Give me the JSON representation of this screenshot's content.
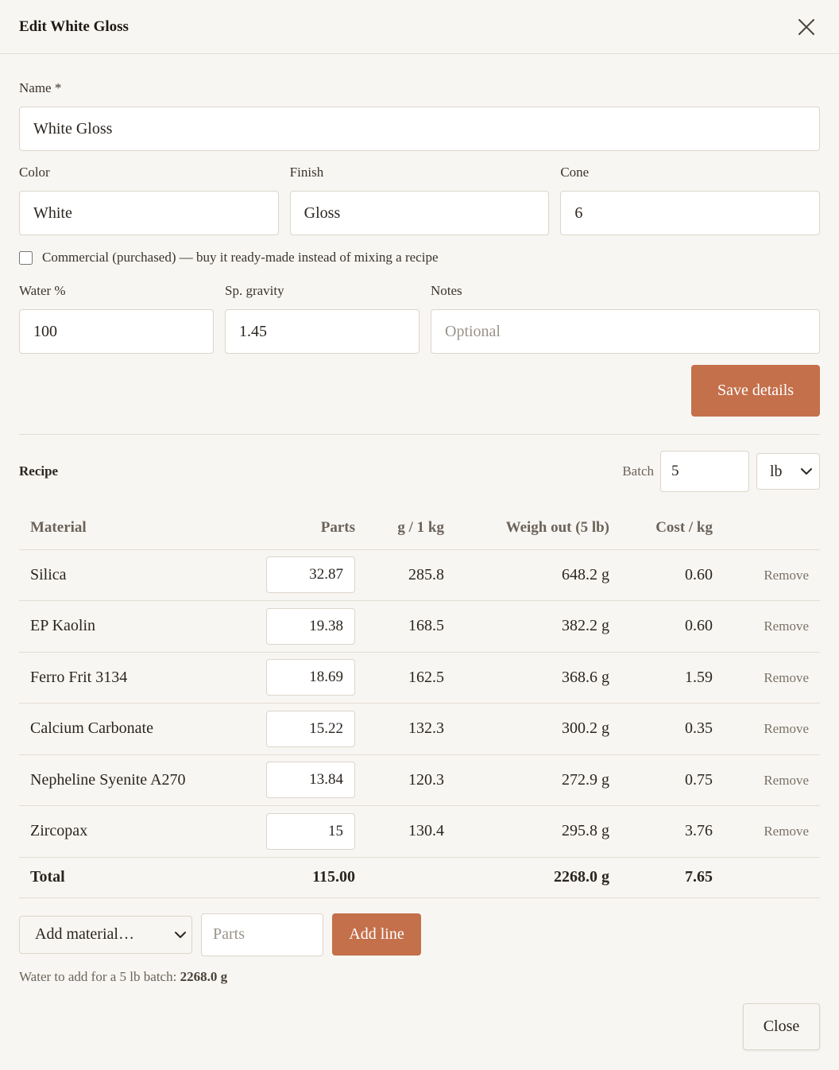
{
  "dialog": {
    "title": "Edit White Gloss"
  },
  "form": {
    "name_label": "Name *",
    "name_value": "White Gloss",
    "color_label": "Color",
    "color_value": "White",
    "finish_label": "Finish",
    "finish_value": "Gloss",
    "cone_label": "Cone",
    "cone_value": "6",
    "commercial_label": "Commercial (purchased) — buy it ready-made instead of mixing a recipe",
    "commercial_checked": false,
    "water_label": "Water %",
    "water_value": "100",
    "sg_label": "Sp. gravity",
    "sg_value": "1.45",
    "notes_label": "Notes",
    "notes_placeholder": "Optional",
    "save_label": "Save details"
  },
  "recipe": {
    "title": "Recipe",
    "batch_label": "Batch",
    "batch_value": "5",
    "unit": "lb",
    "columns": [
      "Material",
      "Parts",
      "g / 1 kg",
      "Weigh out (5 lb)",
      "Cost / kg"
    ],
    "rows": [
      {
        "material": "Silica",
        "parts": "32.87",
        "g_per_kg": "285.8",
        "weigh_out": "648.2 g",
        "cost": "0.60",
        "remove": "Remove"
      },
      {
        "material": "EP Kaolin",
        "parts": "19.38",
        "g_per_kg": "168.5",
        "weigh_out": "382.2 g",
        "cost": "0.60",
        "remove": "Remove"
      },
      {
        "material": "Ferro Frit 3134",
        "parts": "18.69",
        "g_per_kg": "162.5",
        "weigh_out": "368.6 g",
        "cost": "1.59",
        "remove": "Remove"
      },
      {
        "material": "Calcium Carbonate",
        "parts": "15.22",
        "g_per_kg": "132.3",
        "weigh_out": "300.2 g",
        "cost": "0.35",
        "remove": "Remove"
      },
      {
        "material": "Nepheline Syenite A270",
        "parts": "13.84",
        "g_per_kg": "120.3",
        "weigh_out": "272.9 g",
        "cost": "0.75",
        "remove": "Remove"
      },
      {
        "material": "Zircopax",
        "parts": "15",
        "g_per_kg": "130.4",
        "weigh_out": "295.8 g",
        "cost": "3.76",
        "remove": "Remove"
      }
    ],
    "total": {
      "label": "Total",
      "parts": "115.00",
      "weigh_out": "2268.0 g",
      "cost": "7.65"
    },
    "add_material_placeholder": "Add material…",
    "parts_placeholder": "Parts",
    "add_line_label": "Add line",
    "water_note_prefix": "Water to add for a 5 lb batch:",
    "water_note_value": "2268.0 g"
  },
  "footer": {
    "close_label": "Close"
  },
  "colors": {
    "accent": "#c4704b",
    "background": "#f8f6f2",
    "border": "#dcd5cb"
  }
}
